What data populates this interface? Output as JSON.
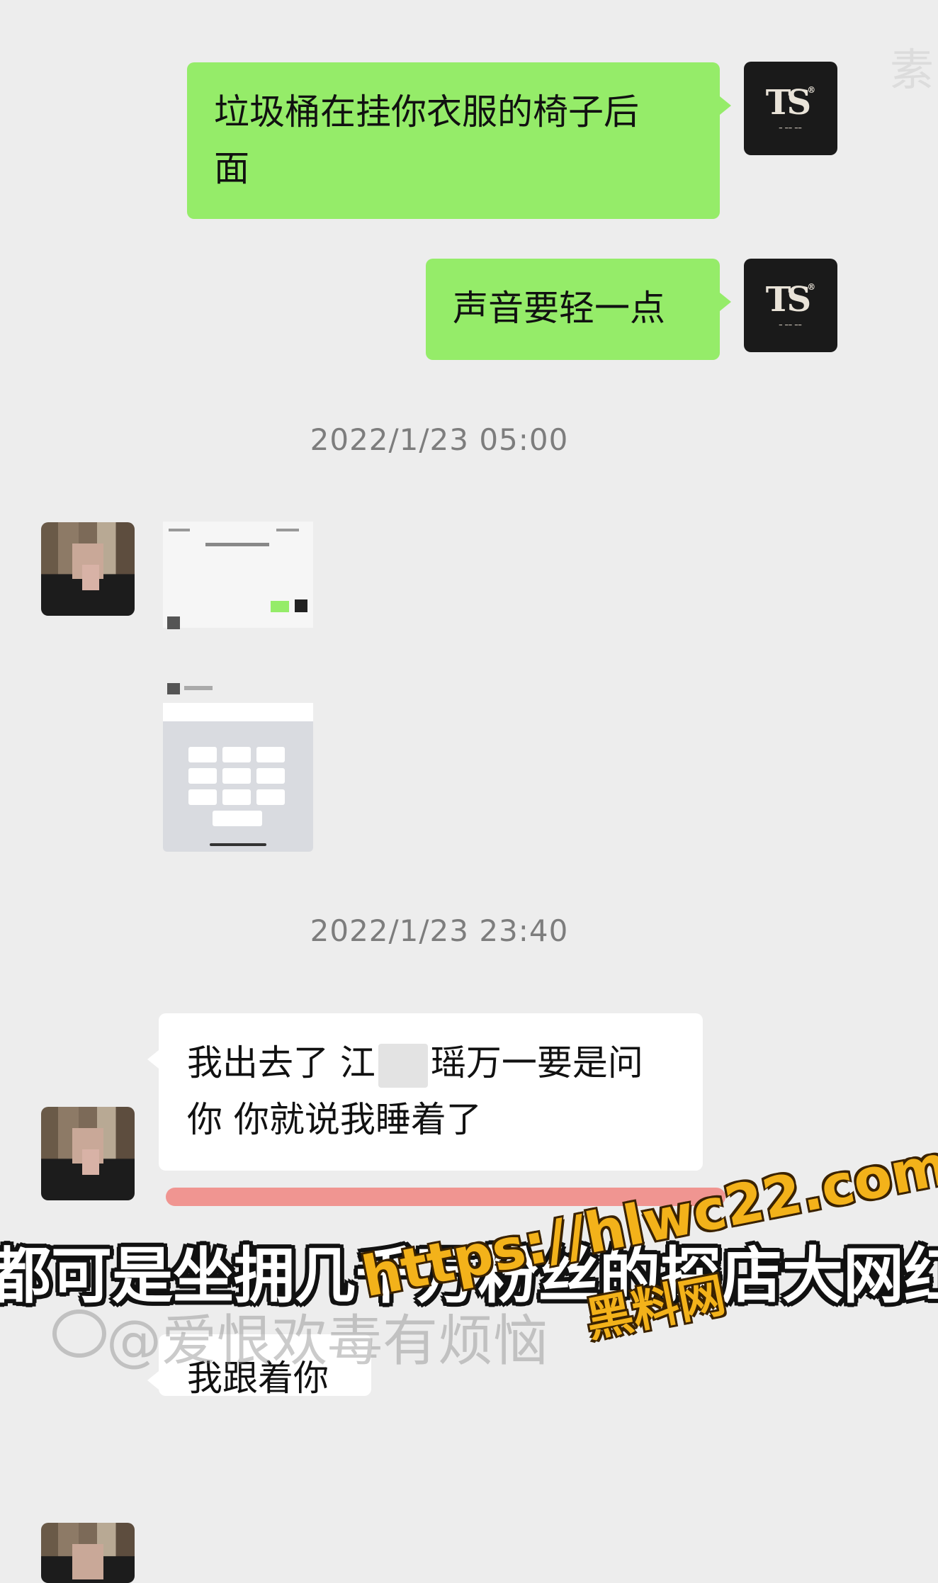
{
  "corner_watermark": "素",
  "messages": [
    {
      "side": "right",
      "text_line1": "垃圾桶在挂你衣服的椅子后",
      "text_line2": "面"
    },
    {
      "side": "right",
      "text": "声音要轻一点"
    },
    {
      "side": "left",
      "type": "image"
    },
    {
      "side": "left",
      "text_part1": "我出去了 江",
      "text_part2": "瑶万一要是问",
      "text_line2": "你 你就说我睡着了"
    },
    {
      "side": "left",
      "text": "我跟着你"
    }
  ],
  "timestamps": [
    "2022/1/23 05:00",
    "2022/1/23 23:40"
  ],
  "avatar_brand": "TS",
  "overlays": {
    "caption": "都可是坐拥几千万粉丝的探店大网红",
    "weibo": "@爱恨欢毒有烦恼",
    "url": "https://hlwc22.com",
    "site": "黑料网"
  },
  "colors": {
    "green_bubble": "#95ec69",
    "background": "#ededed",
    "highlight": "#f08b86",
    "watermark": "#f3b21a"
  }
}
